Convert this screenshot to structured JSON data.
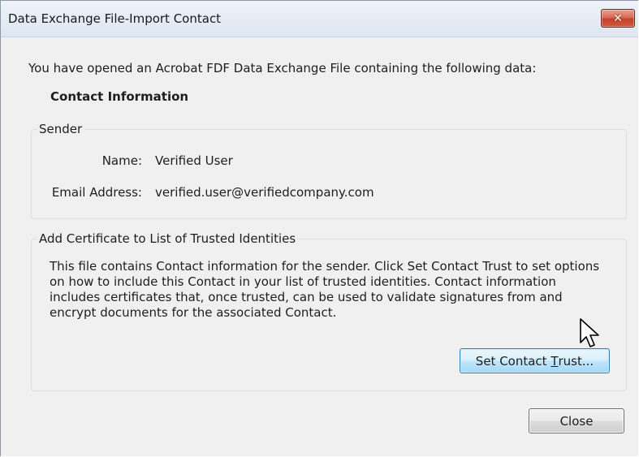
{
  "window": {
    "title": "Data Exchange File-Import Contact"
  },
  "intro_text": "You have opened an Acrobat FDF Data Exchange File containing the following data:",
  "section_heading": "Contact Information",
  "sender": {
    "legend": "Sender",
    "name_label": "Name:",
    "name_value": "Verified User",
    "email_label": "Email Address:",
    "email_value": "verified.user@verifiedcompany.com"
  },
  "trust": {
    "legend": "Add Certificate to List of Trusted Identities",
    "description": "This file contains Contact information for the sender. Click Set Contact Trust to set options on how to include this Contact in your list of trusted identities. Contact information includes certificates that, once trusted, can be used to validate signatures from and encrypt documents for the associated Contact.",
    "button_label_prefix": "Set Contact ",
    "button_label_accel": "T",
    "button_label_suffix": "rust..."
  },
  "buttons": {
    "close_label": "Close"
  },
  "icons": {
    "close": "close-icon",
    "cursor": "mouse-pointer-icon"
  },
  "colors": {
    "close_button": "#c4412a",
    "hover_button_border": "#3c7fb1"
  }
}
